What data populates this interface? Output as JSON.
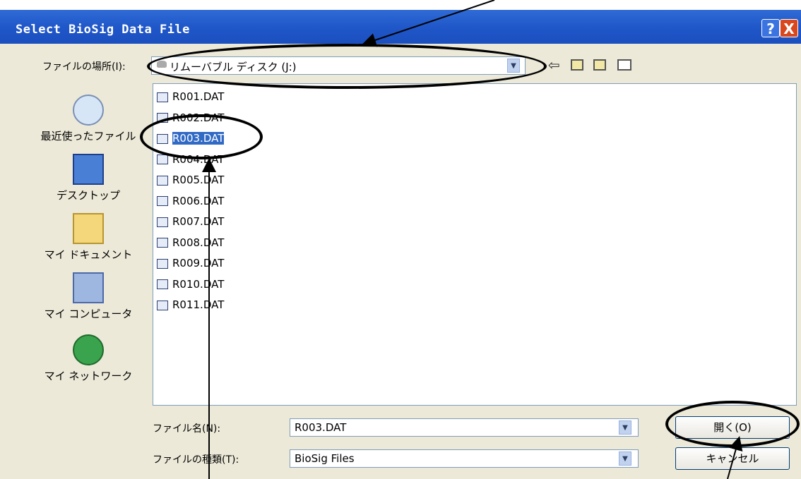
{
  "window": {
    "title": "Select BioSig Data File"
  },
  "titlebar_buttons": {
    "help": "?",
    "close": "X"
  },
  "lookin": {
    "label": "ファイルの場所(I):",
    "value": "リムーバブル ディスク (J:)"
  },
  "toolbar": {
    "back_icon": "back-arrow-icon",
    "up_icon": "up-folder-icon",
    "new_folder_icon": "new-folder-icon",
    "view_icon": "view-menu-icon"
  },
  "places": [
    {
      "label": "最近使ったファイル",
      "icon": "recent-icon"
    },
    {
      "label": "デスクトップ",
      "icon": "desktop-icon"
    },
    {
      "label": "マイ ドキュメント",
      "icon": "documents-icon"
    },
    {
      "label": "マイ コンピュータ",
      "icon": "computer-icon"
    },
    {
      "label": "マイ ネットワーク",
      "icon": "network-icon"
    }
  ],
  "files": [
    "R001.DAT",
    "R002.DAT",
    "R003.DAT",
    "R004.DAT",
    "R005.DAT",
    "R006.DAT",
    "R007.DAT",
    "R008.DAT",
    "R009.DAT",
    "R010.DAT",
    "R011.DAT"
  ],
  "selected_file": "R003.DAT",
  "filename": {
    "label": "ファイル名(N):",
    "value": "R003.DAT"
  },
  "filetype": {
    "label": "ファイルの種類(T):",
    "value": "BioSig Files"
  },
  "buttons": {
    "open": "開く(O)",
    "cancel": "キャンセル"
  },
  "colors": {
    "titlebar": "#1f56c8",
    "dialog_bg": "#ece9d8",
    "selection": "#316ac5",
    "close": "#d9471f"
  }
}
